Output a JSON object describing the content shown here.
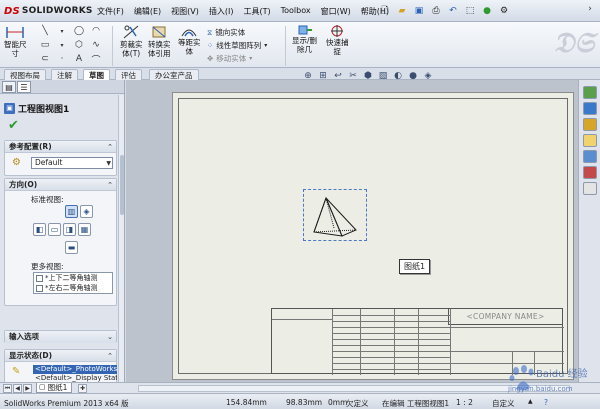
{
  "app": {
    "logo_text": "SOLIDWORKS",
    "logo_mark": "DS",
    "menu": [
      "文件(F)",
      "编辑(E)",
      "视图(V)",
      "插入(I)",
      "工具(T)",
      "Toolbox",
      "窗口(W)",
      "帮助(H)"
    ]
  },
  "command_manager": {
    "smart_dim_label_1": "智能尺",
    "smart_dim_label_2": "寸",
    "trim_label_1": "剪裁实",
    "trim_label_2": "体(T)",
    "convert_label_1": "转换实",
    "convert_label_2": "体引用",
    "offset_label_1": "等距实",
    "offset_label_2": "体",
    "mirror_label": "镜向实体",
    "linear_pattern_label": "线性草图阵列",
    "move_label": "移动实体",
    "show_hide_label_1": "显示/删",
    "show_hide_label_2": "除几",
    "show_hide_label_3": "何关系",
    "quick_snap_label_1": "快速捕",
    "quick_snap_label_2": "捉"
  },
  "tabs": [
    "视图布局",
    "注解",
    "草图",
    "评估",
    "办公室产品"
  ],
  "active_tab": "草图",
  "property_manager": {
    "title": "工程图视图1",
    "ref_config_header": "参考配置(R)",
    "ref_config_value": "Default",
    "orientation_header": "方向(O)",
    "standard_views_label": "标准视图:",
    "more_views_label": "更多视图:",
    "more_views": [
      "*上下二等角轴测",
      "*左右二等角轴测"
    ],
    "import_options_header": "输入选项",
    "display_state_header": "显示状态(D)",
    "display_states": [
      "<Default>_PhotoWorks",
      "<Default>_Display State"
    ]
  },
  "graphics": {
    "tooltip": "图纸1",
    "company_name": "<COMPANY NAME>"
  },
  "sheet_tab": "图纸1",
  "status_bar": {
    "product": "SolidWorks Premium 2013 x64 版",
    "x": "154.84mm",
    "y": "98.83mm",
    "z": "0mm",
    "defined_state": "欠定义",
    "editing": "在编辑 工程图视图1",
    "scale": "1 : 2",
    "custom": "自定义"
  },
  "watermark_text": "Baidu 经验",
  "watermark_url": "jingyan.baidu.com",
  "colors": {
    "accent_blue": "#3465b3",
    "logo_red": "#cc0000",
    "sheet_bg": "#eceee6",
    "check_green": "#2f9a2f"
  }
}
